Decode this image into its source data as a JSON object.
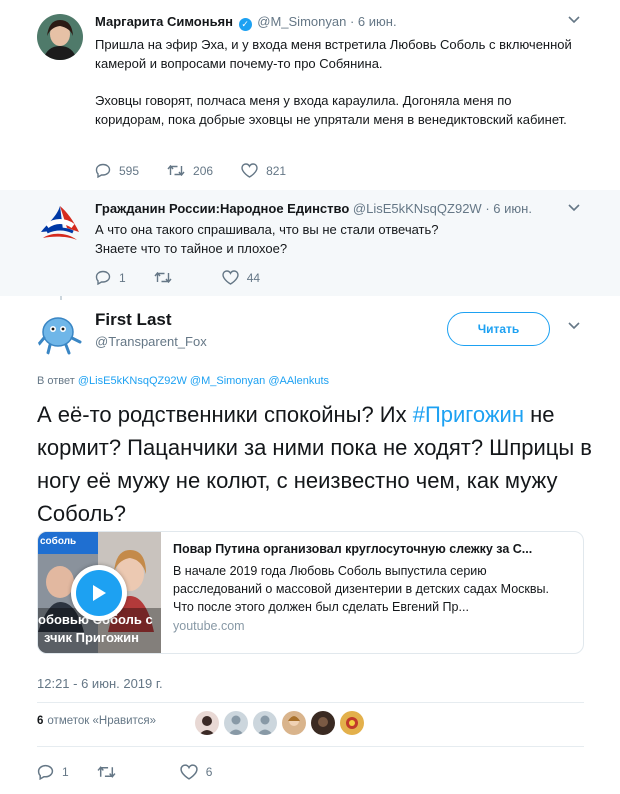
{
  "tweet1": {
    "name": "Маргарита Симоньян",
    "handle": "@M_Simonyan",
    "sep": "·",
    "date": "6 июн.",
    "text_p1": "Пришла на эфир Эха, и у входа меня встретила Любовь Соболь с включенной камерой и вопросами почему-то про Собянина.",
    "text_p2": "Эховцы говорят, полчаса меня у входа караулила. Догоняла меня по коридорам, пока добрые эховцы не упрятали меня в венедиктовский кабинет.",
    "replies": "595",
    "retweets": "206",
    "likes": "821"
  },
  "tweet2": {
    "name": "Гражданин России:Народное Единство",
    "handle": "@LisE5kKNsqQZ92W",
    "sep": "·",
    "date": "6 июн.",
    "text": "А что она такого спрашивала,  что вы не стали отвечать? Знаете что то тайное и плохое?",
    "replies": "1",
    "retweets": "",
    "likes": "44"
  },
  "tweet3": {
    "name": "First Last",
    "handle": "@Transparent_Fox",
    "follow_label": "Читать",
    "reply_prefix": "В ответ",
    "reply_handles": "@LisE5kKNsqQZ92W @M_Simonyan @AAlenkuts",
    "text_before": "А её-то родственники спокойны? Их ",
    "hashtag": "#Пригожин",
    "text_after": " не кормит? Пацанчики за ними пока не ходят? Шприцы в ногу её мужу не колют, с неизвестно чем, как мужу Соболь?",
    "card": {
      "title": "Повар Путина организовал круглосуточную слежку за С...",
      "description": "В начале 2019 года Любовь Соболь выпустила серию расследований о массовой дизентерии в детских садах Москвы. Что после этого должен был сделать Евгений Пр...",
      "domain": "youtube.com",
      "thumb_tag": "соболь",
      "thumb_line1": "обовью Соболь с",
      "thumb_line2": "зчик Пригожин"
    },
    "timestamp": "12:21 - 6 июн. 2019 г.",
    "likes_count": "6",
    "likes_label": "отметок «Нравится»",
    "replies": "1",
    "retweets": "",
    "likes": "6"
  },
  "colors": {
    "accent": "#1da1f2",
    "muted": "#657786",
    "border": "#e6ecf0",
    "reply_bg": "#f5f8fa"
  },
  "icons": [
    "chevron-down-icon",
    "reply-icon",
    "retweet-icon",
    "like-icon",
    "verified-icon",
    "play-icon"
  ]
}
